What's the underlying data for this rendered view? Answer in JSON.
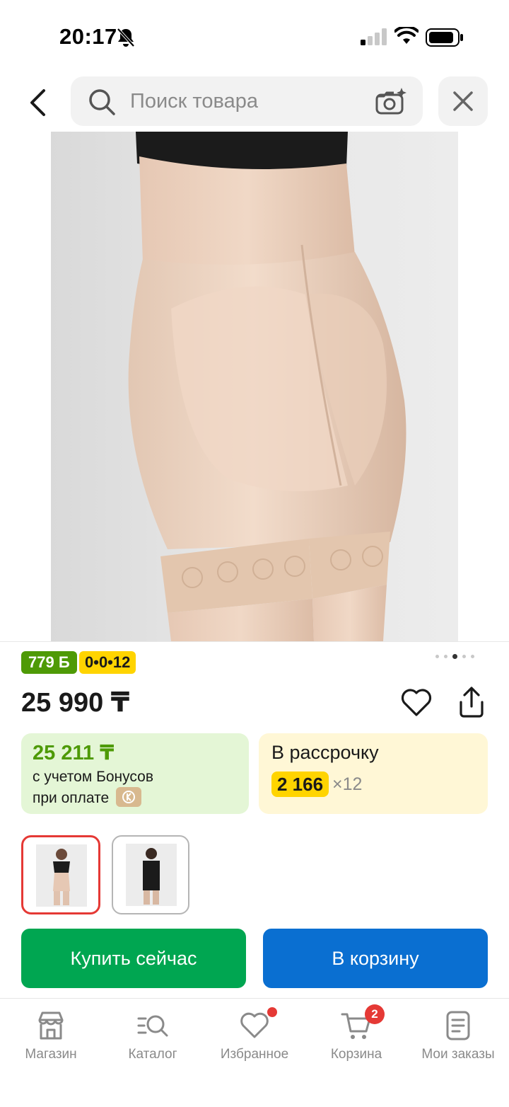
{
  "status_bar": {
    "time": "20:17"
  },
  "search": {
    "placeholder": "Поиск товара"
  },
  "product": {
    "bonus_points": "779 Б",
    "installment_badge": "0•0•12",
    "price": "25 990 ₸",
    "gallery_pages": 5,
    "gallery_active_index": 2
  },
  "bonus_card": {
    "price": "25 211 ₸",
    "line1": "с учетом Бонусов",
    "line2": "при оплате"
  },
  "installment_card": {
    "title": "В рассрочку",
    "amount": "2 166",
    "times": "×12"
  },
  "actions": {
    "buy_now": "Купить сейчас",
    "add_to_cart": "В корзину"
  },
  "bottom_nav": {
    "items": [
      {
        "label": "Магазин",
        "icon": "store-icon"
      },
      {
        "label": "Каталог",
        "icon": "catalog-search-icon"
      },
      {
        "label": "Избранное",
        "icon": "heart-icon"
      },
      {
        "label": "Корзина",
        "icon": "cart-icon",
        "badge": "2"
      },
      {
        "label": "Мои заказы",
        "icon": "orders-icon"
      }
    ]
  },
  "colors": {
    "green_accent": "#4e9a06",
    "yellow_accent": "#ffd400",
    "buy_button": "#00a651",
    "cart_button": "#0a6fd1",
    "badge_red": "#e53935"
  }
}
